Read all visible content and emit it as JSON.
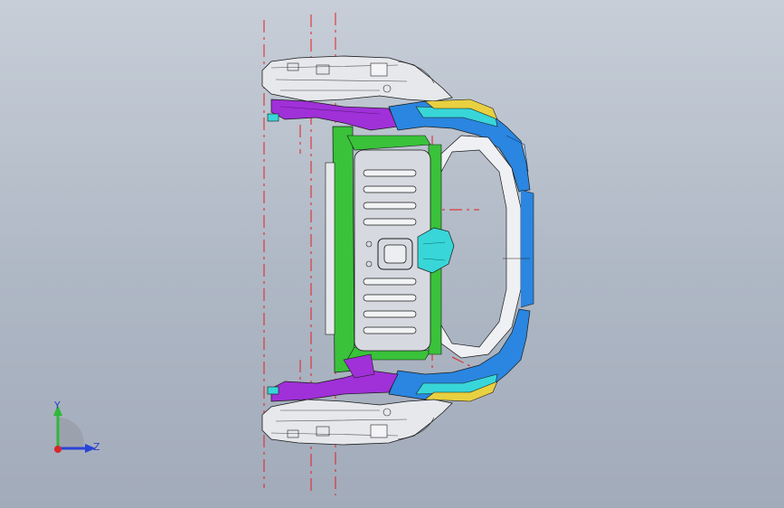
{
  "viewport": {
    "background_top": "#c7ced8",
    "background_bottom": "#a2abba"
  },
  "triad": {
    "y_label": "Y",
    "z_label": "Z",
    "y_color": "#2fb83a",
    "z_color": "#2a44d8",
    "x_color": "#d8262a"
  },
  "model": {
    "part_colors": {
      "white_body": "#e6e8ec",
      "purple": "#a030d8",
      "green": "#39c23a",
      "blue": "#2a86e0",
      "cyan": "#38d6d8",
      "yellow": "#e8d040",
      "panel_gray": "#d6d9df"
    },
    "centerline_color": "#e02020",
    "edge_color": "#1a1a1a"
  }
}
